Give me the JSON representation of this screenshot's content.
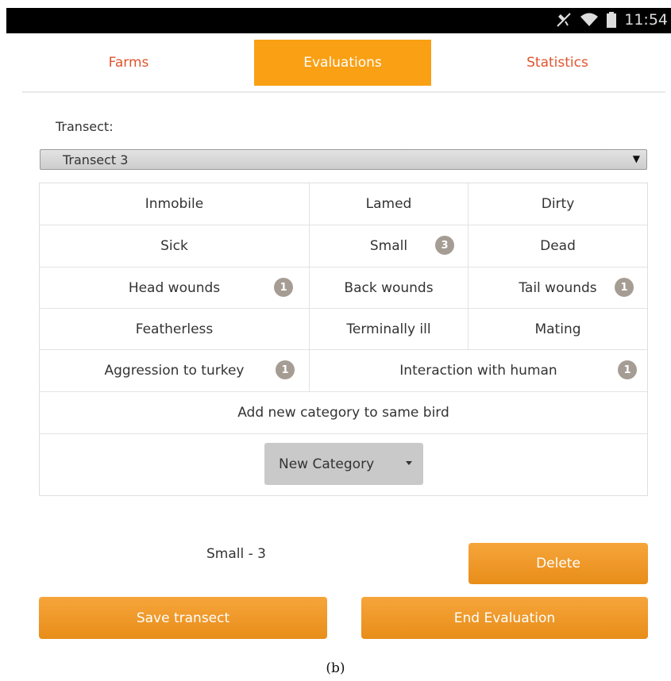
{
  "status_bar": {
    "time": "11:54"
  },
  "tabs": [
    {
      "label": "Farms"
    },
    {
      "label": "Evaluations"
    },
    {
      "label": "Statistics"
    }
  ],
  "transect": {
    "label": "Transect:",
    "selected": "Transect 3"
  },
  "categories": [
    {
      "label": "Inmobile",
      "count": ""
    },
    {
      "label": "Lamed",
      "count": ""
    },
    {
      "label": "Dirty",
      "count": ""
    },
    {
      "label": "Sick",
      "count": ""
    },
    {
      "label": "Small",
      "count": "3"
    },
    {
      "label": "Dead",
      "count": ""
    },
    {
      "label": "Head wounds",
      "count": "1"
    },
    {
      "label": "Back wounds",
      "count": ""
    },
    {
      "label": "Tail wounds",
      "count": "1"
    },
    {
      "label": "Featherless",
      "count": ""
    },
    {
      "label": "Terminally ill",
      "count": ""
    },
    {
      "label": "Mating",
      "count": ""
    },
    {
      "label": "Aggression to turkey",
      "count": "1"
    },
    {
      "label": "Interaction with human",
      "count": "1"
    }
  ],
  "add_category_label": "Add new category to same bird",
  "new_category_dropdown": "New Category",
  "selection_summary": "Small - 3",
  "buttons": {
    "delete": "Delete",
    "save_transect": "Save transect",
    "end_evaluation": "End Evaluation"
  },
  "caption": "(b)",
  "colors": {
    "accent_orange": "#f9a014",
    "tab_text": "#e0542e",
    "badge": "#a59d94"
  }
}
